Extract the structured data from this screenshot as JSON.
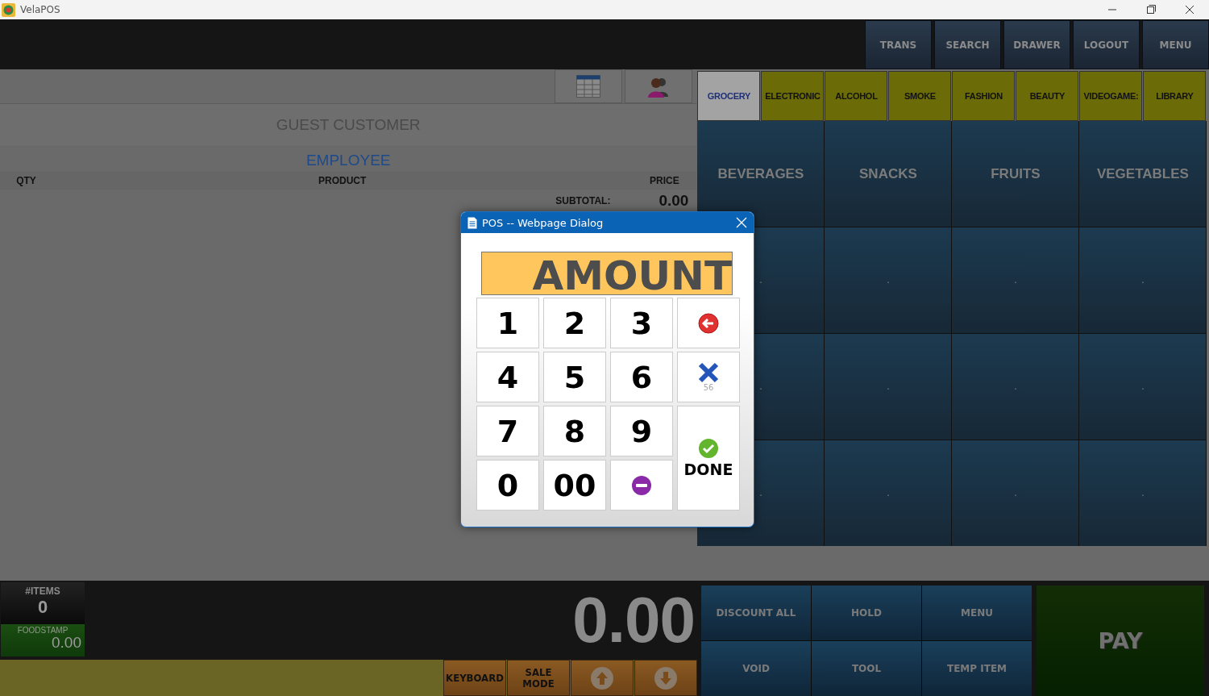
{
  "window": {
    "title": "VelaPOS"
  },
  "top_buttons": [
    "TRANS",
    "SEARCH",
    "DRAWER",
    "LOGOUT",
    "MENU"
  ],
  "customer": {
    "name": "GUEST CUSTOMER",
    "employee": "EMPLOYEE"
  },
  "table": {
    "columns": [
      "QTY",
      "PRODUCT",
      "PRICE"
    ]
  },
  "subtotal": {
    "label": "SUBTOTAL:",
    "value": "0.00"
  },
  "categories": [
    {
      "label": "GROCERY",
      "selected": true
    },
    {
      "label": "ELECTRONIC",
      "selected": false
    },
    {
      "label": "ALCOHOL",
      "selected": false
    },
    {
      "label": "SMOKE",
      "selected": false
    },
    {
      "label": "FASHION",
      "selected": false
    },
    {
      "label": "BEAUTY",
      "selected": false
    },
    {
      "label": "VIDEOGAME:",
      "selected": false
    },
    {
      "label": "LIBRARY",
      "selected": false
    }
  ],
  "tiles": [
    "BEVERAGES",
    "SNACKS",
    "FRUITS",
    "VEGETABLES",
    ".",
    ".",
    ".",
    ".",
    ".",
    ".",
    ".",
    ".",
    ".",
    ".",
    ".",
    "."
  ],
  "counters": {
    "items_label": "#ITEMS",
    "items": "0",
    "foodstamp_label": "FOODSTAMP",
    "foodstamp": "0.00"
  },
  "total": "0.00",
  "bottom_buttons": [
    {
      "kind": "text",
      "label": "KEYBOARD"
    },
    {
      "kind": "text",
      "label": "SALE MODE"
    },
    {
      "kind": "up"
    },
    {
      "kind": "down"
    }
  ],
  "actions": [
    "DISCOUNT ALL",
    "HOLD",
    "MENU",
    "VOID",
    "TOOL",
    "TEMP ITEM"
  ],
  "pay": "PAY",
  "dialog": {
    "title": "POS -- Webpage Dialog",
    "display": "AMOUNT",
    "keys": [
      {
        "kind": "digit",
        "label": "1"
      },
      {
        "kind": "digit",
        "label": "2"
      },
      {
        "kind": "digit",
        "label": "3"
      },
      {
        "kind": "back"
      },
      {
        "kind": "digit",
        "label": "4"
      },
      {
        "kind": "digit",
        "label": "5"
      },
      {
        "kind": "digit",
        "label": "6"
      },
      {
        "kind": "clear",
        "label": "56"
      },
      {
        "kind": "digit",
        "label": "7"
      },
      {
        "kind": "digit",
        "label": "8"
      },
      {
        "kind": "digit",
        "label": "9"
      },
      {
        "kind": "done",
        "label": "DONE"
      },
      {
        "kind": "digit",
        "label": "0"
      },
      {
        "kind": "digit",
        "label": "00"
      },
      {
        "kind": "minus"
      }
    ]
  }
}
